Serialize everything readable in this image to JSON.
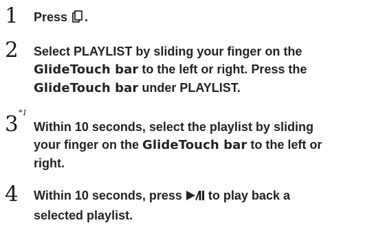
{
  "steps": [
    {
      "number": "1",
      "text_before_icon": "Press ",
      "icon": "menu-icon",
      "text_after_icon": "."
    },
    {
      "number": "2",
      "line1": "Select PLAYLIST by sliding your finger on the",
      "glide_1": "GlideTouch bar",
      "line2_rest": " to the left or right. Press the",
      "glide_2": "GlideTouch bar",
      "line3_rest": " under PLAYLIST."
    },
    {
      "number": "3",
      "footnote": "*1",
      "line1": "Within 10 seconds, select the playlist by sliding",
      "line2_start": "your finger on the ",
      "glide": "GlideTouch bar",
      "line2_end": " to the left or",
      "line3": "right."
    },
    {
      "number": "4",
      "line1_start": "Within 10 seconds, press ",
      "icon": "play-pause-icon",
      "line1_end": " to play back a",
      "line2": "selected playlist."
    }
  ]
}
